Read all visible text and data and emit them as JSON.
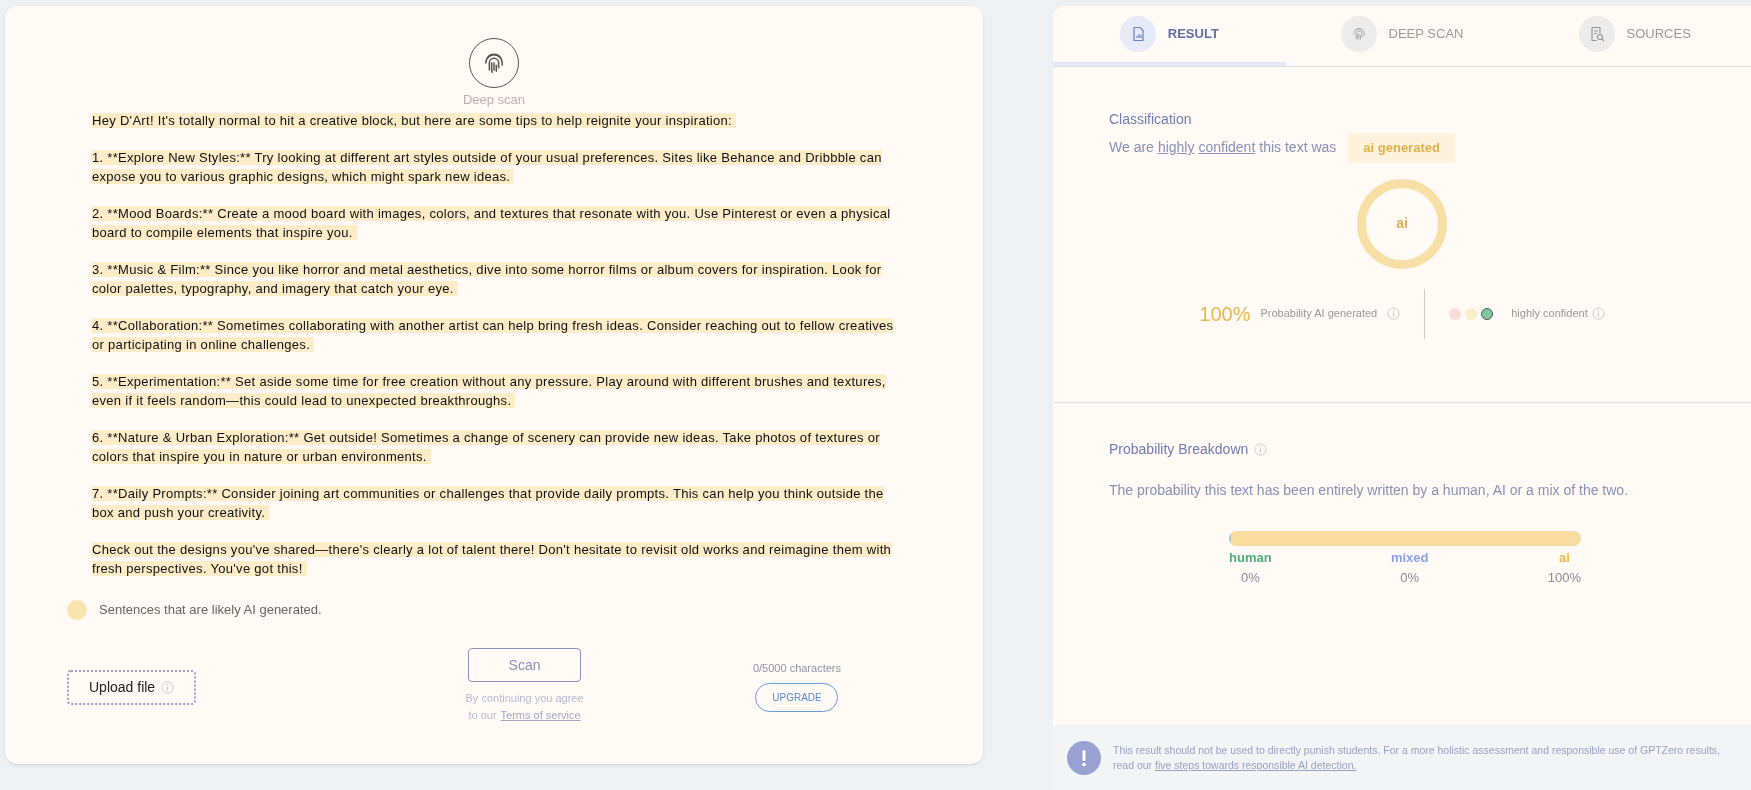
{
  "scan_panel": {
    "mode_label": "Deep scan",
    "paragraphs": [
      {
        "text": "Hey D'Art! It's totally normal to hit a creative block, but here are some tips to help reignite your inspiration:",
        "highlighted": true
      },
      {
        "text": "1. **Explore New Styles:** Try looking at different art styles outside of your usual preferences. Sites like Behance and Dribbble can expose you to various graphic designs, which might spark new ideas.",
        "highlighted": true
      },
      {
        "text": "2. **Mood Boards:** Create a mood board with images, colors, and textures that resonate with you. Use Pinterest or even a physical board to compile elements that inspire you.",
        "highlighted": true
      },
      {
        "text": "3. **Music & Film:** Since you like horror and metal aesthetics, dive into some horror films or album covers for inspiration. Look for color palettes, typography, and imagery that catch your eye.",
        "highlighted": true
      },
      {
        "text": "4. **Collaboration:** Sometimes collaborating with another artist can help bring fresh ideas. Consider reaching out to fellow creatives or participating in online challenges.",
        "highlighted": true
      },
      {
        "text": "5. **Experimentation:** Set aside some time for free creation without any pressure. Play around with different brushes and textures, even if it feels random—this could lead to unexpected breakthroughs.",
        "highlighted": true
      },
      {
        "text": "6. **Nature & Urban Exploration:** Get outside! Sometimes a change of scenery can provide new ideas. Take photos of textures or colors that inspire you in nature or urban environments.",
        "highlighted": true
      },
      {
        "text": "7. **Daily Prompts:** Consider joining art communities or challenges that provide daily prompts. This can help you think outside the box and push your creativity.",
        "highlighted": true
      },
      {
        "text": "Check out the designs you've shared—there's clearly a lot of talent there! Don't hesitate to revisit old works and reimagine them with fresh perspectives. You've got this!",
        "highlighted": true
      }
    ],
    "legend": {
      "color": "#f9e4ad",
      "label": "Sentences that are likely AI generated."
    },
    "upload_button": "Upload file",
    "scan_button": "Scan",
    "terms_text": "By continuing you agree",
    "terms_prefix": "to our",
    "terms_link": "Terms of service",
    "char_count": "0/5000 characters",
    "upgrade_button": "UPGRADE"
  },
  "result_panel": {
    "tabs": [
      {
        "label": "RESULT",
        "selected": true,
        "kind": "chart"
      },
      {
        "label": "DEEP SCAN",
        "selected": false,
        "kind": "fingerprint"
      },
      {
        "label": "SOURCES",
        "selected": false,
        "kind": "search"
      }
    ],
    "classification": {
      "title": "Classification",
      "sentence_start": "We are",
      "word_1": "highly",
      "word_2": "confident",
      "sentence_end": "this text was",
      "verdict": "ai generated",
      "ring_label": "ai",
      "percent": "100%",
      "percent_label": "Probability AI generated",
      "confidence_dots": [
        {
          "color": "#fbdcdc",
          "selected": false
        },
        {
          "color": "#fbefc9",
          "selected": false
        },
        {
          "color": "#7fc9a0",
          "selected": true
        }
      ],
      "confidence_label": "highly confident"
    },
    "breakdown": {
      "title": "Probability Breakdown",
      "description": "The probability this text has been entirely written by a human, AI or a mix of the two.",
      "segments": [
        {
          "label": "human",
          "value": "0%",
          "level": 0.005,
          "color": "#4caf7f"
        },
        {
          "label": "mixed",
          "value": "0%",
          "color": "#8ea2e8"
        },
        {
          "label": "ai",
          "value": "100%",
          "level": 0.995,
          "color": "#e8b84a"
        }
      ]
    },
    "notice": {
      "text": "This result should not be used to directly punish students. For a more holistic assessment and responsible use of GPTZero results, read our",
      "link": "five steps towards responsible AI detection."
    }
  }
}
